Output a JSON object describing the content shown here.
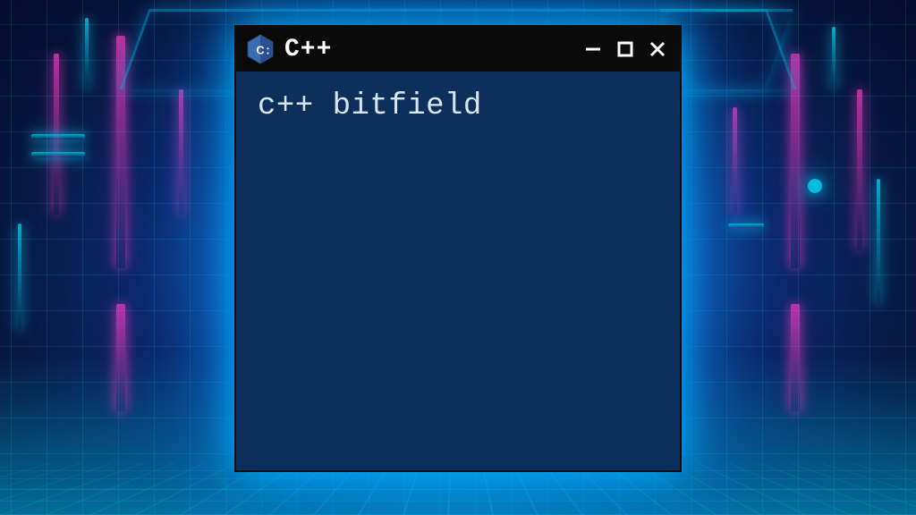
{
  "window": {
    "app_title": "C++",
    "icon_label": "C++",
    "content_text": "c++ bitfield"
  },
  "colors": {
    "titlebar_bg": "#0a0a0a",
    "content_bg": "#0d2f5c",
    "text": "#d8e6f0",
    "neon_pink": "#ff3cc8",
    "neon_cyan": "#00e6ff"
  }
}
